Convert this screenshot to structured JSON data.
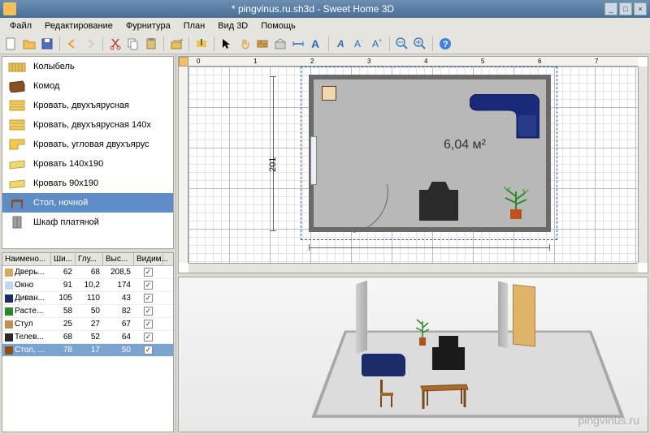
{
  "window": {
    "title": "* pingvinus.ru.sh3d - Sweet Home 3D"
  },
  "menu": {
    "file": "Файл",
    "edit": "Редактирование",
    "furniture": "Фурнитура",
    "plan": "План",
    "view3d": "Вид 3D",
    "help": "Помощь"
  },
  "catalog": [
    {
      "name": "Колыбель"
    },
    {
      "name": "Комод"
    },
    {
      "name": "Кровать, двухъярусная"
    },
    {
      "name": "Кровать, двухъярусная 140x"
    },
    {
      "name": "Кровать, угловая двухъярус"
    },
    {
      "name": "Кровать 140x190"
    },
    {
      "name": "Кровать 90x190"
    },
    {
      "name": "Стол, ночной",
      "selected": true
    },
    {
      "name": "Шкаф платяной"
    }
  ],
  "furniture_columns": {
    "name": "Наимено...",
    "width": "Ши...",
    "depth": "Глу...",
    "height": "Выс...",
    "visible": "Видим..."
  },
  "furniture_rows": [
    {
      "name": "Дверь...",
      "w": "62",
      "d": "68",
      "h": "208,5",
      "v": true
    },
    {
      "name": "Окно",
      "w": "91",
      "d": "10,2",
      "h": "174",
      "v": true
    },
    {
      "name": "Диван...",
      "w": "105",
      "d": "110",
      "h": "43",
      "v": true
    },
    {
      "name": "Расте...",
      "w": "58",
      "d": "50",
      "h": "82",
      "v": true
    },
    {
      "name": "Стул",
      "w": "25",
      "d": "27",
      "h": "67",
      "v": true
    },
    {
      "name": "Телев...",
      "w": "68",
      "d": "52",
      "h": "64",
      "v": true
    },
    {
      "name": "Стол, ...",
      "w": "78",
      "d": "17",
      "h": "50",
      "v": true,
      "selected": true
    }
  ],
  "plan": {
    "ruler_marks": [
      "0",
      "1",
      "2",
      "3",
      "4",
      "5",
      "6",
      "7"
    ],
    "room_area": "6,04 м²",
    "dim_v": "201"
  },
  "watermark": "pingvinus.ru"
}
